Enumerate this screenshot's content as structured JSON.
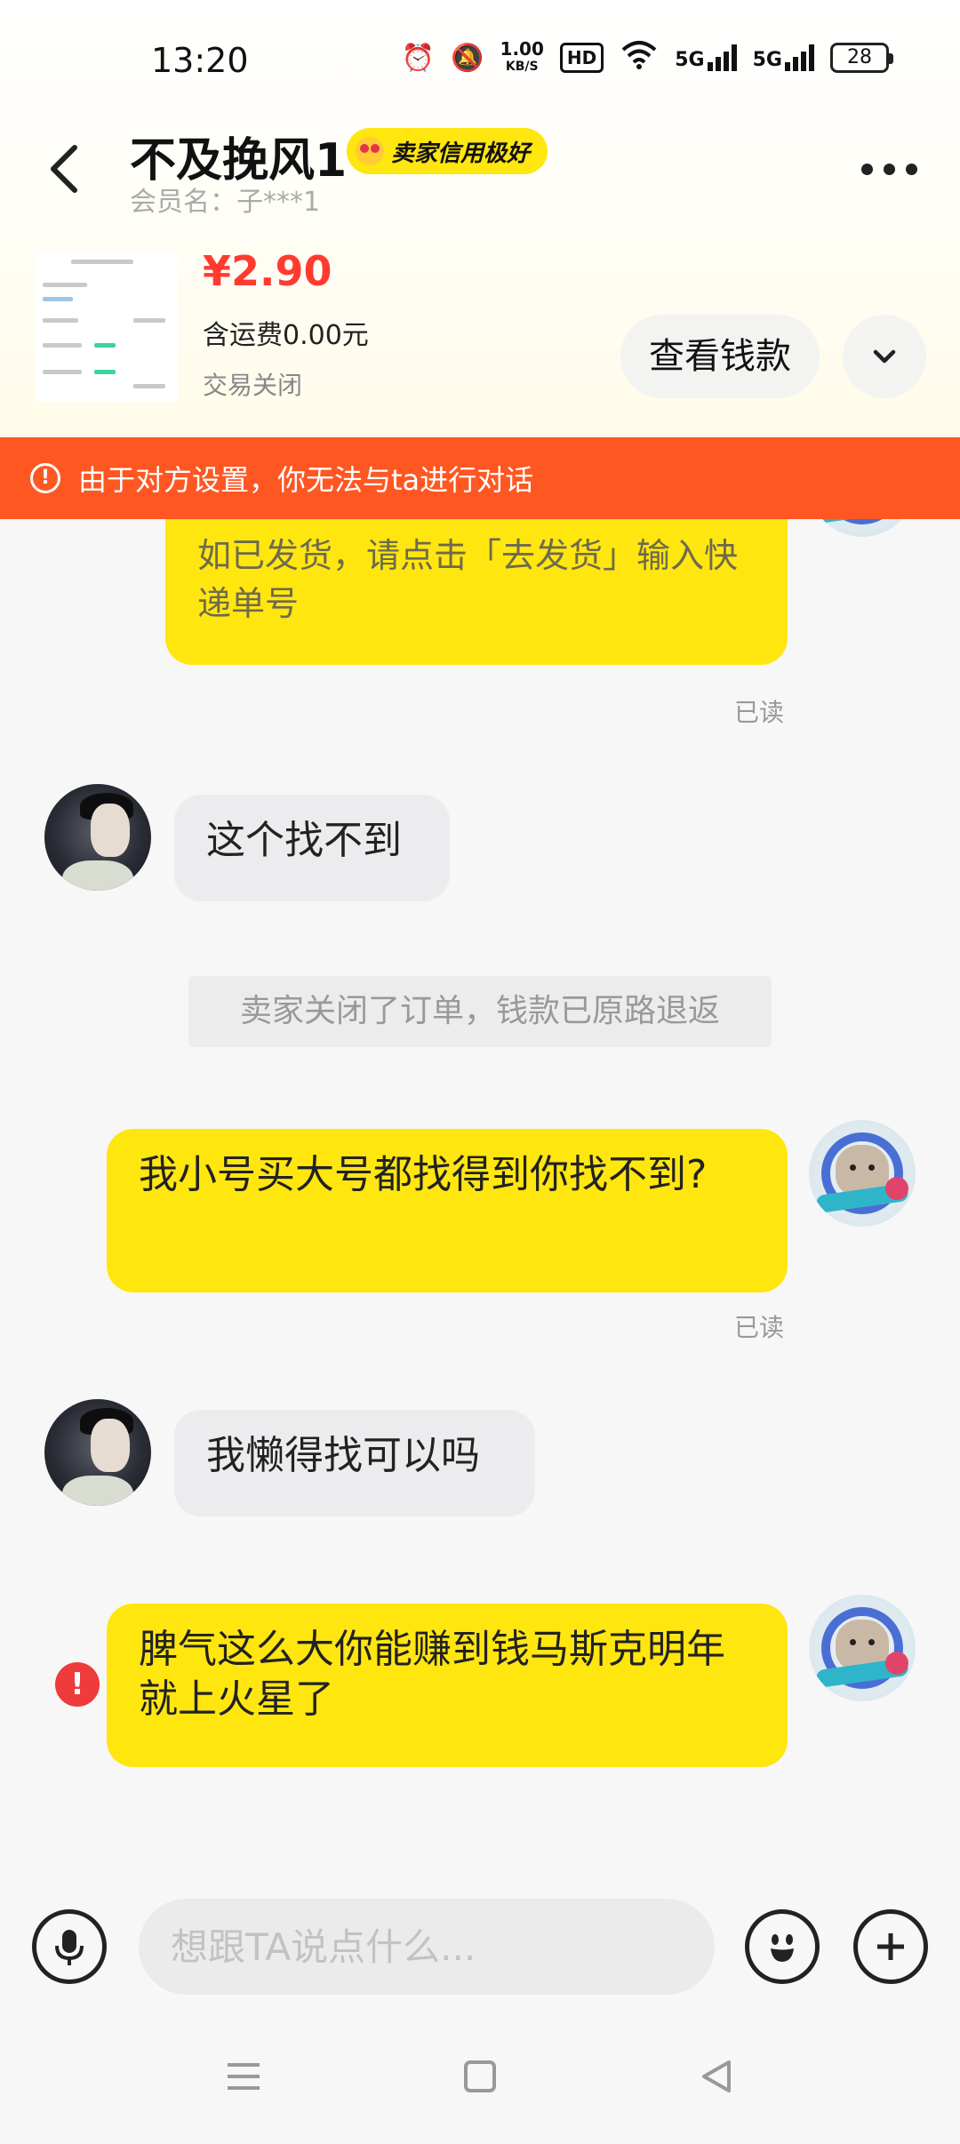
{
  "status_bar": {
    "time": "13:20",
    "net_speed_value": "1.00",
    "net_speed_unit": "KB/S",
    "hd_label": "HD",
    "signal1": "5G",
    "signal2": "5G",
    "battery": "28"
  },
  "header": {
    "title": "不及挽风1",
    "credit_badge": "卖家信用极好",
    "member_name": "会员名：子***1"
  },
  "order": {
    "price": "¥2.90",
    "shipping": "含运费0.00元",
    "status": "交易关闭",
    "view_money_label": "查看钱款"
  },
  "banner": {
    "text": "由于对方设置，你无法与ta进行对话"
  },
  "messages": {
    "m1_text": "如已发货，请点击「去发货」输入快递单号",
    "m1_read": "已读",
    "m2_text": "这个找不到",
    "system_text": "卖家关闭了订单，钱款已原路退返",
    "m3_text": "我小号买大号都找得到你找不到?",
    "m3_read": "已读",
    "m4_text": "我懒得找可以吗",
    "m5_text": "脾气这么大你能赚到钱马斯克明年就上火星了"
  },
  "input": {
    "placeholder": "想跟TA说点什么..."
  },
  "colors": {
    "accent_yellow": "#ffe60f",
    "banner_orange": "#ff5722",
    "price_red": "#ff3b30",
    "error_red": "#ef3b3b"
  },
  "icons": [
    "back-arrow-icon",
    "more-icon",
    "chevron-down-icon",
    "warning-icon",
    "error-icon",
    "mic-icon",
    "emoji-icon",
    "plus-icon",
    "menu-icon",
    "home-icon",
    "back-nav-icon"
  ]
}
